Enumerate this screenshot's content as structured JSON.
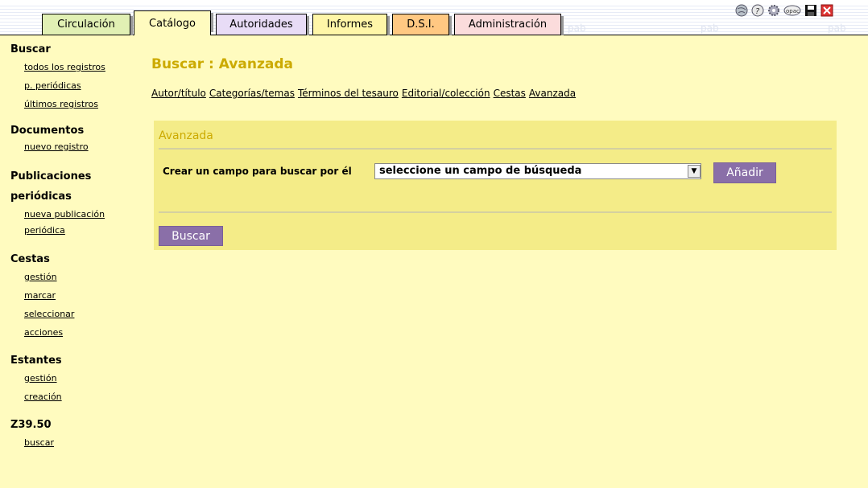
{
  "tabs": [
    {
      "label": "Circulación",
      "color": "#e1f0b4"
    },
    {
      "label": "Catálogo",
      "color": "#fffbbf"
    },
    {
      "label": "Autoridades",
      "color": "#e8dcf6"
    },
    {
      "label": "Informes",
      "color": "#fff6a8"
    },
    {
      "label": "D.S.I.",
      "color": "#ffc882"
    },
    {
      "label": "Administración",
      "color": "#fbdcdc"
    }
  ],
  "toolbar_icons": [
    "globe-icon",
    "help-icon",
    "settings-icon",
    "opac-icon",
    "save-icon",
    "close-icon"
  ],
  "sidebar": {
    "buscar": {
      "heading": "Buscar",
      "links": [
        "todos los registros",
        "p. periódicas",
        "últimos registros"
      ]
    },
    "documentos": {
      "heading": "Documentos",
      "links": [
        "nuevo registro"
      ]
    },
    "publicaciones": {
      "heading_line1": "Publicaciones",
      "heading_line2": "periódicas",
      "links": [
        "nueva publicación",
        "periódica"
      ]
    },
    "cestas": {
      "heading": "Cestas",
      "links": [
        "gestión",
        "marcar",
        "seleccionar",
        "acciones"
      ]
    },
    "estantes": {
      "heading": "Estantes",
      "links": [
        "gestión",
        "creación"
      ]
    },
    "z3950": {
      "heading": "Z39.50",
      "links": [
        "buscar"
      ]
    }
  },
  "main": {
    "title": "Buscar : Avanzada",
    "subnav": [
      "Autor/título",
      "Categorías/temas",
      "Términos del tesauro",
      "Editorial/colección",
      "Cestas",
      "Avanzada"
    ],
    "panel": {
      "title": "Avanzada",
      "field_label": "Crear un campo para buscar por él",
      "select_value": "seleccione un campo de búsqueda",
      "add_button": "Añadir",
      "search_button": "Buscar"
    }
  },
  "colors": {
    "background": "#fffbbf",
    "title": "#ccaa00",
    "panel": "#f4ec88",
    "button": "#8a6fa8"
  }
}
